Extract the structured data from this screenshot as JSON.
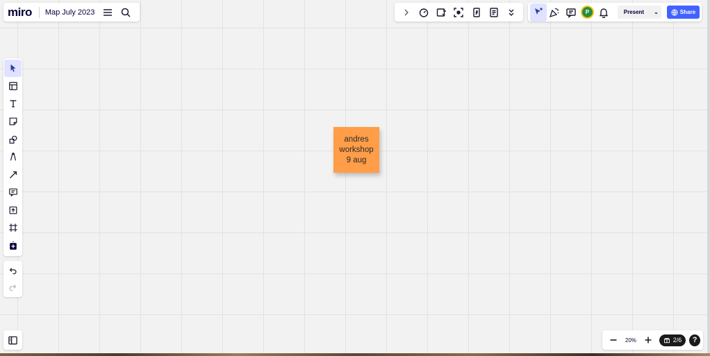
{
  "app": {
    "logo": "miro",
    "board_title": "Map July 2023"
  },
  "top_toolbar": {
    "present_label": "Present",
    "share_label": "Share",
    "avatar_initial": "P"
  },
  "zoom": {
    "level": "20%"
  },
  "pages": {
    "indicator": "2/6"
  },
  "help": {
    "label": "?"
  },
  "sticky_note": {
    "lines": [
      "andres",
      "workshop",
      "9 aug"
    ],
    "color": "#ff9d48"
  },
  "colors": {
    "accent": "#4262ff",
    "canvas": "#f2f2f2",
    "active_tool": "#dfe3ff",
    "avatar": "#2a8c3f"
  }
}
